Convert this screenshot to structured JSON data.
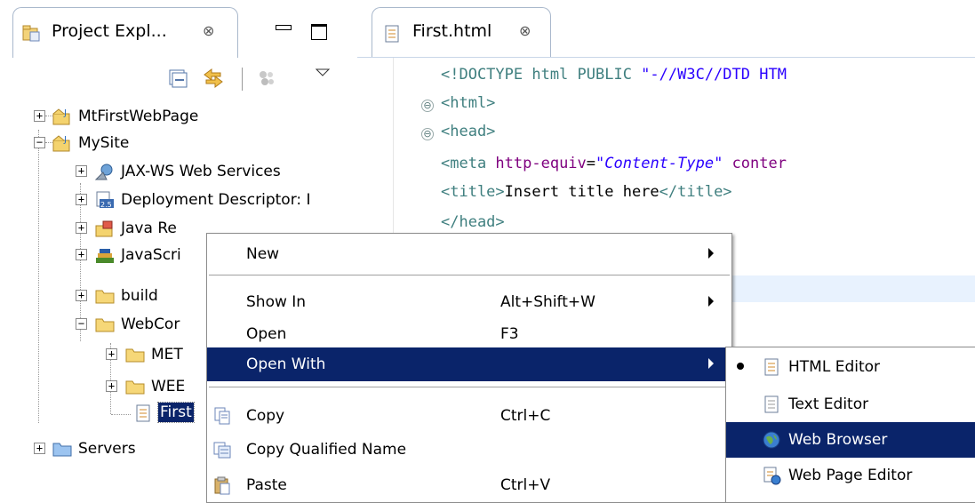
{
  "explorer": {
    "tab_label": "Project Expl...",
    "close_glyph": "⊗",
    "icons": [
      "collapse-all-icon",
      "link-with-editor-icon",
      "filter-icon",
      "view-menu-icon"
    ],
    "tree": [
      {
        "label": "MtFirstWebPage",
        "expander": "+",
        "icon": "web-project-icon"
      },
      {
        "label": "MySite",
        "expander": "−",
        "icon": "web-project-icon"
      },
      {
        "label": "JAX-WS Web Services",
        "expander": "+",
        "icon": "web-services-icon"
      },
      {
        "label": "Deployment Descriptor: I",
        "expander": "+",
        "icon": "deployment-descriptor-icon"
      },
      {
        "label": "Java Re",
        "expander": "+",
        "icon": "java-resources-icon"
      },
      {
        "label": "JavaScri",
        "expander": "+",
        "icon": "javascript-resources-icon"
      },
      {
        "label": "build",
        "expander": "+",
        "icon": "folder-icon"
      },
      {
        "label": "WebCor",
        "expander": "−",
        "icon": "folder-icon"
      },
      {
        "label": "MET",
        "expander": "+",
        "icon": "folder-icon"
      },
      {
        "label": "WEE",
        "expander": "+",
        "icon": "folder-icon"
      },
      {
        "label": "First",
        "expander": "",
        "icon": "html-file-icon"
      },
      {
        "label": "Servers",
        "expander": "+",
        "icon": "folder-icon"
      }
    ]
  },
  "editor": {
    "tab_label": "First.html",
    "close_glyph": "⊗",
    "lines": {
      "l1_a": "<!DOCTYPE html PUBLIC ",
      "l1_b": "\"-//W3C//DTD HTM",
      "l2": "<html>",
      "l3": "<head>",
      "l4_a": "<meta ",
      "l4_b": "http-equiv",
      "l4_c": "=",
      "l4_d": "\"Content-Type\"",
      "l4_e": " conter",
      "l5_a": "<title>",
      "l5_b": "Insert title here",
      "l5_c": "</title>",
      "l6": "</head>"
    },
    "fold_glyph": "⊖"
  },
  "context_menu": {
    "items": [
      {
        "label": "New",
        "shortcut": "",
        "submenu": true
      },
      {
        "label": "Show In",
        "shortcut": "Alt+Shift+W",
        "submenu": true
      },
      {
        "label": "Open",
        "shortcut": "F3",
        "submenu": false
      },
      {
        "label": "Open With",
        "shortcut": "",
        "submenu": true,
        "selected": true
      },
      {
        "label": "Copy",
        "shortcut": "Ctrl+C",
        "submenu": false,
        "icon": "copy-icon"
      },
      {
        "label": "Copy Qualified Name",
        "shortcut": "",
        "submenu": false,
        "icon": "copy-qualified-name-icon"
      },
      {
        "label": "Paste",
        "shortcut": "Ctrl+V",
        "submenu": false,
        "icon": "paste-icon"
      }
    ]
  },
  "open_with_menu": {
    "items": [
      {
        "label": "HTML Editor",
        "icon": "html-editor-icon",
        "checked": true
      },
      {
        "label": "Text Editor",
        "icon": "text-editor-icon",
        "checked": false
      },
      {
        "label": "Web Browser",
        "icon": "web-browser-icon",
        "checked": false,
        "selected": true
      },
      {
        "label": "Web Page Editor",
        "icon": "web-page-editor-icon",
        "checked": false
      }
    ]
  },
  "colors": {
    "selection": "#0a246a",
    "tag": "#3f7f7f",
    "attribute": "#7f007f",
    "string": "#2a00ff",
    "current_line": "#e8f2fe"
  }
}
